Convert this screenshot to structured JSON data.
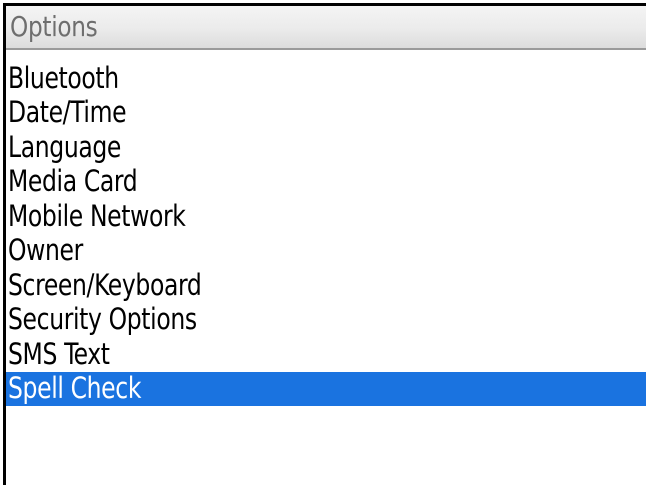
{
  "title_bar": {
    "title": "Options"
  },
  "options_list": {
    "items": [
      {
        "label": "Bluetooth",
        "selected": false
      },
      {
        "label": "Date/Time",
        "selected": false
      },
      {
        "label": "Language",
        "selected": false
      },
      {
        "label": "Media Card",
        "selected": false
      },
      {
        "label": "Mobile Network",
        "selected": false
      },
      {
        "label": "Owner",
        "selected": false
      },
      {
        "label": "Screen/Keyboard",
        "selected": false
      },
      {
        "label": "Security Options",
        "selected": false
      },
      {
        "label": "SMS Text",
        "selected": false
      },
      {
        "label": "Spell Check",
        "selected": true
      }
    ]
  },
  "colors": {
    "selection_highlight": "#1a73e0",
    "title_text": "#6e6e6e",
    "item_text": "#000000",
    "selected_text": "#ffffff"
  }
}
